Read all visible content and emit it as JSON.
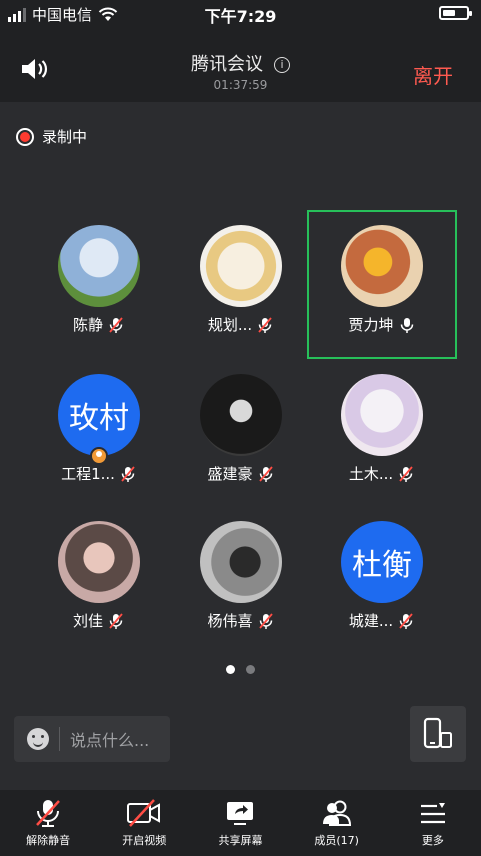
{
  "status_bar": {
    "carrier": "中国电信",
    "time": "下午7:29"
  },
  "header": {
    "title": "腾讯会议",
    "timer": "01:37:59",
    "leave_label": "离开"
  },
  "recording": {
    "label": "录制中"
  },
  "participants": [
    {
      "name": "陈静",
      "mic": "muted",
      "avatar": "photo"
    },
    {
      "name": "规划...",
      "mic": "muted",
      "avatar": "photo"
    },
    {
      "name": "贾力坤",
      "mic": "on",
      "avatar": "photo",
      "speaking": true
    },
    {
      "name": "工程1...",
      "mic": "muted",
      "avatar": "text",
      "avatar_text": "玫村",
      "host": true
    },
    {
      "name": "盛建豪",
      "mic": "muted",
      "avatar": "photo"
    },
    {
      "name": "土木...",
      "mic": "muted",
      "avatar": "photo"
    },
    {
      "name": "刘佳",
      "mic": "muted",
      "avatar": "photo"
    },
    {
      "name": "杨伟喜",
      "mic": "muted",
      "avatar": "photo"
    },
    {
      "name": "城建...",
      "mic": "muted",
      "avatar": "text",
      "avatar_text": "杜衡"
    }
  ],
  "pager": {
    "current_page": 1,
    "total_pages": 2
  },
  "chat": {
    "placeholder": "说点什么..."
  },
  "bottom_bar": {
    "unmute": "解除静音",
    "video": "开启视频",
    "share": "共享屏幕",
    "members": "成员(17)",
    "more": "更多"
  },
  "colors": {
    "leave": "#ff5a50",
    "speaking_border": "#27c05a",
    "text_avatar": "#1e6bf0",
    "recording": "#ff3b30"
  }
}
